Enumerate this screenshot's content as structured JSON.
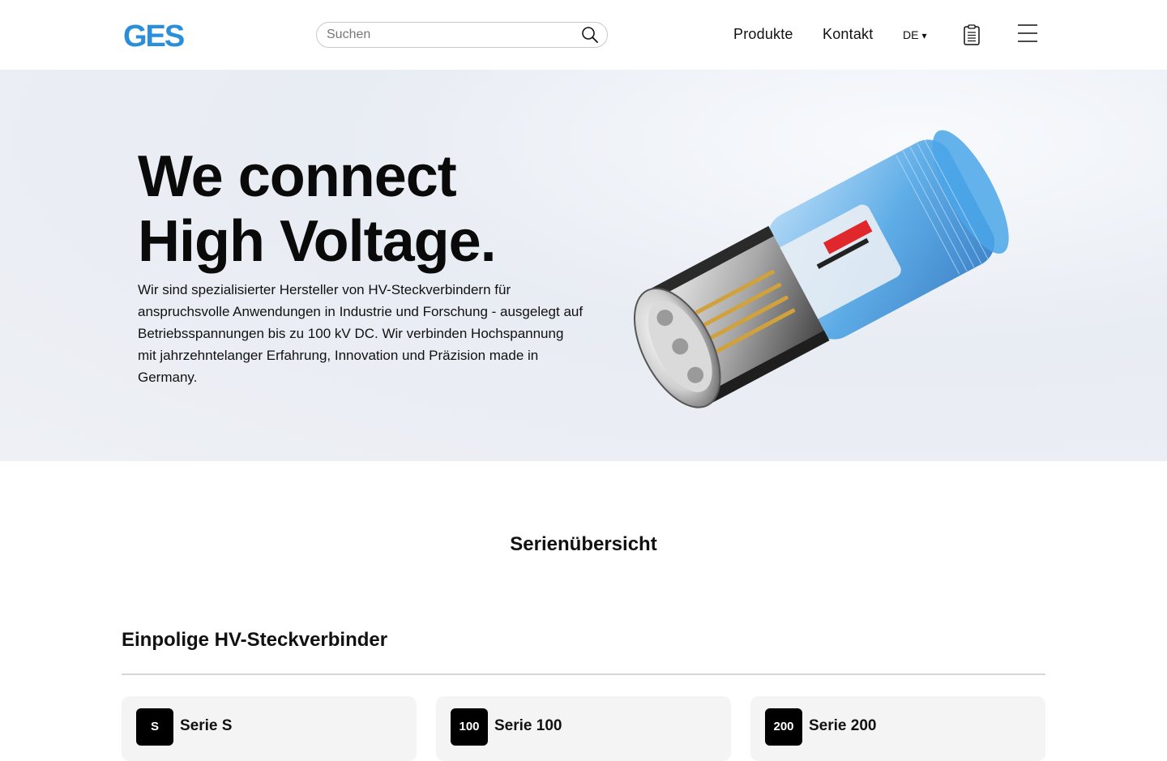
{
  "header": {
    "logo_text": "GES",
    "search": {
      "placeholder": "Suchen",
      "value": ""
    },
    "nav": [
      {
        "label": "Produkte"
      },
      {
        "label": "Kontakt"
      }
    ],
    "language": {
      "label": "DE",
      "caret": "▾"
    }
  },
  "hero": {
    "title_line1": "We connect",
    "title_line2": "High Voltage.",
    "description": "Wir sind spezialisierter Hersteller von HV-Steckverbindern für anspruchsvolle Anwendungen in Industrie und Forschung - ausgelegt auf Betriebsspannungen bis zu 100 kV DC. Wir verbinden Hochspannung mit jahrzehntelanger Erfahrung, Innovation und Präzision made in Germany."
  },
  "series": {
    "heading": "Serienübersicht",
    "groups": [
      {
        "heading": "Einpolige HV-Steckverbinder",
        "cards": [
          {
            "badge": "S",
            "title": "Serie S"
          },
          {
            "badge": "100",
            "title": "Serie 100"
          },
          {
            "badge": "200",
            "title": "Serie 200"
          }
        ]
      }
    ]
  },
  "colors": {
    "brand_blue": "#2a8fd8",
    "hero_bg": "#eef0f5",
    "card_bg": "#f4f4f4",
    "badge_bg": "#000000"
  },
  "icons": [
    "search-icon",
    "clipboard-icon",
    "hamburger-menu-icon",
    "chevron-down-icon"
  ]
}
